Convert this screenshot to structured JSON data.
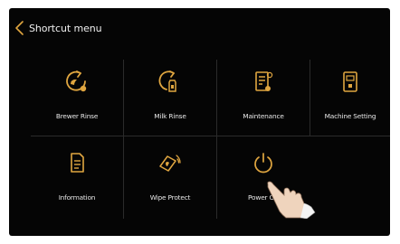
{
  "header": {
    "back_icon": "chevron-left-icon",
    "title": "Shortcut menu"
  },
  "accent_color": "#e0a640",
  "tiles": [
    {
      "label": "Brewer Rinse",
      "icon": "brewer-rinse-icon"
    },
    {
      "label": "Milk Rinse",
      "icon": "milk-rinse-icon"
    },
    {
      "label": "Maintenance",
      "icon": "maintenance-icon"
    },
    {
      "label": "Machine Setting",
      "icon": "machine-setting-icon"
    },
    {
      "label": "Information",
      "icon": "information-icon"
    },
    {
      "label": "Wipe Protect",
      "icon": "wipe-protect-icon"
    },
    {
      "label": "Power Off",
      "icon": "power-icon"
    }
  ]
}
